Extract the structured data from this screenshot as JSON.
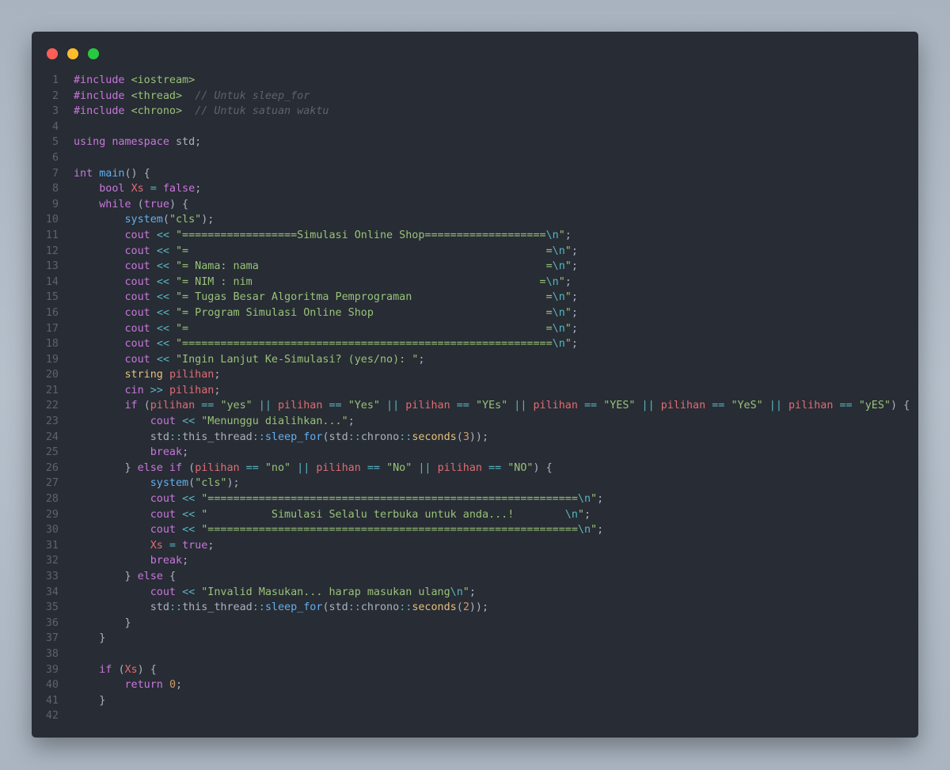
{
  "window": {
    "controls": [
      {
        "name": "close",
        "color": "#ff5f56"
      },
      {
        "name": "minimize",
        "color": "#ffbd2e"
      },
      {
        "name": "maximize",
        "color": "#27c93f"
      }
    ]
  },
  "code": {
    "lines": [
      [
        [
          "pre",
          "#include "
        ],
        [
          "inc",
          "<iostream>"
        ]
      ],
      [
        [
          "pre",
          "#include "
        ],
        [
          "inc",
          "<thread>"
        ],
        [
          "plain",
          "  "
        ],
        [
          "com",
          "// Untuk sleep_for"
        ]
      ],
      [
        [
          "pre",
          "#include "
        ],
        [
          "inc",
          "<chrono>"
        ],
        [
          "plain",
          "  "
        ],
        [
          "com",
          "// Untuk satuan waktu"
        ]
      ],
      [],
      [
        [
          "kw",
          "using namespace "
        ],
        [
          "plain",
          "std;"
        ]
      ],
      [],
      [
        [
          "kw",
          "int "
        ],
        [
          "func",
          "main"
        ],
        [
          "plain",
          "() {"
        ]
      ],
      [
        [
          "plain",
          "    "
        ],
        [
          "kw",
          "bool "
        ],
        [
          "var",
          "Xs"
        ],
        [
          "op",
          " = "
        ],
        [
          "kw",
          "false"
        ],
        [
          "plain",
          ";"
        ]
      ],
      [
        [
          "plain",
          "    "
        ],
        [
          "kw",
          "while "
        ],
        [
          "plain",
          "("
        ],
        [
          "kw",
          "true"
        ],
        [
          "plain",
          ") {"
        ]
      ],
      [
        [
          "plain",
          "        "
        ],
        [
          "func",
          "system"
        ],
        [
          "plain",
          "("
        ],
        [
          "str",
          "\"cls\""
        ],
        [
          "plain",
          ");"
        ]
      ],
      [
        [
          "plain",
          "        "
        ],
        [
          "kw",
          "cout "
        ],
        [
          "op",
          "<< "
        ],
        [
          "str",
          "\"==================Simulasi Online Shop==================="
        ],
        [
          "esc",
          "\\n"
        ],
        [
          "str",
          "\""
        ],
        [
          "plain",
          ";"
        ]
      ],
      [
        [
          "plain",
          "        "
        ],
        [
          "kw",
          "cout "
        ],
        [
          "op",
          "<< "
        ],
        [
          "str",
          "\"=                                                        ="
        ],
        [
          "esc",
          "\\n"
        ],
        [
          "str",
          "\""
        ],
        [
          "plain",
          ";"
        ]
      ],
      [
        [
          "plain",
          "        "
        ],
        [
          "kw",
          "cout "
        ],
        [
          "op",
          "<< "
        ],
        [
          "str",
          "\"= Nama: nama                                             ="
        ],
        [
          "esc",
          "\\n"
        ],
        [
          "str",
          "\""
        ],
        [
          "plain",
          ";"
        ]
      ],
      [
        [
          "plain",
          "        "
        ],
        [
          "kw",
          "cout "
        ],
        [
          "op",
          "<< "
        ],
        [
          "str",
          "\"= NIM : nim                                             ="
        ],
        [
          "esc",
          "\\n"
        ],
        [
          "str",
          "\""
        ],
        [
          "plain",
          ";"
        ]
      ],
      [
        [
          "plain",
          "        "
        ],
        [
          "kw",
          "cout "
        ],
        [
          "op",
          "<< "
        ],
        [
          "str",
          "\"= Tugas Besar Algoritma Pemprograman                     ="
        ],
        [
          "esc",
          "\\n"
        ],
        [
          "str",
          "\""
        ],
        [
          "plain",
          ";"
        ]
      ],
      [
        [
          "plain",
          "        "
        ],
        [
          "kw",
          "cout "
        ],
        [
          "op",
          "<< "
        ],
        [
          "str",
          "\"= Program Simulasi Online Shop                           ="
        ],
        [
          "esc",
          "\\n"
        ],
        [
          "str",
          "\""
        ],
        [
          "plain",
          ";"
        ]
      ],
      [
        [
          "plain",
          "        "
        ],
        [
          "kw",
          "cout "
        ],
        [
          "op",
          "<< "
        ],
        [
          "str",
          "\"=                                                        ="
        ],
        [
          "esc",
          "\\n"
        ],
        [
          "str",
          "\""
        ],
        [
          "plain",
          ";"
        ]
      ],
      [
        [
          "plain",
          "        "
        ],
        [
          "kw",
          "cout "
        ],
        [
          "op",
          "<< "
        ],
        [
          "str",
          "\"=========================================================="
        ],
        [
          "esc",
          "\\n"
        ],
        [
          "str",
          "\""
        ],
        [
          "plain",
          ";"
        ]
      ],
      [
        [
          "plain",
          "        "
        ],
        [
          "kw",
          "cout "
        ],
        [
          "op",
          "<< "
        ],
        [
          "str",
          "\"Ingin Lanjut Ke-Simulasi? (yes/no): \""
        ],
        [
          "plain",
          ";"
        ]
      ],
      [
        [
          "plain",
          "        "
        ],
        [
          "type",
          "string "
        ],
        [
          "var",
          "pilihan"
        ],
        [
          "plain",
          ";"
        ]
      ],
      [
        [
          "plain",
          "        "
        ],
        [
          "kw",
          "cin "
        ],
        [
          "op",
          ">> "
        ],
        [
          "var",
          "pilihan"
        ],
        [
          "plain",
          ";"
        ]
      ],
      [
        [
          "plain",
          "        "
        ],
        [
          "kw",
          "if "
        ],
        [
          "plain",
          "("
        ],
        [
          "var",
          "pilihan"
        ],
        [
          "op",
          " == "
        ],
        [
          "str",
          "\"yes\""
        ],
        [
          "op",
          " || "
        ],
        [
          "var",
          "pilihan"
        ],
        [
          "op",
          " == "
        ],
        [
          "str",
          "\"Yes\""
        ],
        [
          "op",
          " || "
        ],
        [
          "var",
          "pilihan"
        ],
        [
          "op",
          " == "
        ],
        [
          "str",
          "\"YEs\""
        ],
        [
          "op",
          " || "
        ],
        [
          "var",
          "pilihan"
        ],
        [
          "op",
          " == "
        ],
        [
          "str",
          "\"YES\""
        ],
        [
          "op",
          " || "
        ],
        [
          "var",
          "pilihan"
        ],
        [
          "op",
          " == "
        ],
        [
          "str",
          "\"YeS\""
        ],
        [
          "op",
          " || "
        ],
        [
          "var",
          "pilihan"
        ],
        [
          "op",
          " == "
        ],
        [
          "str",
          "\"yES\""
        ],
        [
          "plain",
          ") {"
        ]
      ],
      [
        [
          "plain",
          "            "
        ],
        [
          "kw",
          "cout "
        ],
        [
          "op",
          "<< "
        ],
        [
          "str",
          "\"Menunggu dialihkan...\""
        ],
        [
          "plain",
          ";"
        ]
      ],
      [
        [
          "plain",
          "            std"
        ],
        [
          "op",
          "::"
        ],
        [
          "plain",
          "this_thread"
        ],
        [
          "op",
          "::"
        ],
        [
          "func",
          "sleep_for"
        ],
        [
          "plain",
          "(std"
        ],
        [
          "op",
          "::"
        ],
        [
          "plain",
          "chrono"
        ],
        [
          "op",
          "::"
        ],
        [
          "fn2",
          "seconds"
        ],
        [
          "plain",
          "("
        ],
        [
          "num",
          "3"
        ],
        [
          "plain",
          "));"
        ]
      ],
      [
        [
          "plain",
          "            "
        ],
        [
          "kw",
          "break"
        ],
        [
          "plain",
          ";"
        ]
      ],
      [
        [
          "plain",
          "        } "
        ],
        [
          "kw",
          "else if "
        ],
        [
          "plain",
          "("
        ],
        [
          "var",
          "pilihan"
        ],
        [
          "op",
          " == "
        ],
        [
          "str",
          "\"no\""
        ],
        [
          "op",
          " || "
        ],
        [
          "var",
          "pilihan"
        ],
        [
          "op",
          " == "
        ],
        [
          "str",
          "\"No\""
        ],
        [
          "op",
          " || "
        ],
        [
          "var",
          "pilihan"
        ],
        [
          "op",
          " == "
        ],
        [
          "str",
          "\"NO\""
        ],
        [
          "plain",
          ") {"
        ]
      ],
      [
        [
          "plain",
          "            "
        ],
        [
          "func",
          "system"
        ],
        [
          "plain",
          "("
        ],
        [
          "str",
          "\"cls\""
        ],
        [
          "plain",
          ");"
        ]
      ],
      [
        [
          "plain",
          "            "
        ],
        [
          "kw",
          "cout "
        ],
        [
          "op",
          "<< "
        ],
        [
          "str",
          "\"=========================================================="
        ],
        [
          "esc",
          "\\n"
        ],
        [
          "str",
          "\""
        ],
        [
          "plain",
          ";"
        ]
      ],
      [
        [
          "plain",
          "            "
        ],
        [
          "kw",
          "cout "
        ],
        [
          "op",
          "<< "
        ],
        [
          "str",
          "\"          Simulasi Selalu terbuka untuk anda...!        "
        ],
        [
          "esc",
          "\\n"
        ],
        [
          "str",
          "\""
        ],
        [
          "plain",
          ";"
        ]
      ],
      [
        [
          "plain",
          "            "
        ],
        [
          "kw",
          "cout "
        ],
        [
          "op",
          "<< "
        ],
        [
          "str",
          "\"=========================================================="
        ],
        [
          "esc",
          "\\n"
        ],
        [
          "str",
          "\""
        ],
        [
          "plain",
          ";"
        ]
      ],
      [
        [
          "plain",
          "            "
        ],
        [
          "var",
          "Xs"
        ],
        [
          "op",
          " = "
        ],
        [
          "kw",
          "true"
        ],
        [
          "plain",
          ";"
        ]
      ],
      [
        [
          "plain",
          "            "
        ],
        [
          "kw",
          "break"
        ],
        [
          "plain",
          ";"
        ]
      ],
      [
        [
          "plain",
          "        } "
        ],
        [
          "kw",
          "else "
        ],
        [
          "plain",
          "{"
        ]
      ],
      [
        [
          "plain",
          "            "
        ],
        [
          "kw",
          "cout "
        ],
        [
          "op",
          "<< "
        ],
        [
          "str",
          "\"Invalid Masukan... harap masukan ulang"
        ],
        [
          "esc",
          "\\n"
        ],
        [
          "str",
          "\""
        ],
        [
          "plain",
          ";"
        ]
      ],
      [
        [
          "plain",
          "            std"
        ],
        [
          "op",
          "::"
        ],
        [
          "plain",
          "this_thread"
        ],
        [
          "op",
          "::"
        ],
        [
          "func",
          "sleep_for"
        ],
        [
          "plain",
          "(std"
        ],
        [
          "op",
          "::"
        ],
        [
          "plain",
          "chrono"
        ],
        [
          "op",
          "::"
        ],
        [
          "fn2",
          "seconds"
        ],
        [
          "plain",
          "("
        ],
        [
          "num",
          "2"
        ],
        [
          "plain",
          "));"
        ]
      ],
      [
        [
          "plain",
          "        }"
        ]
      ],
      [
        [
          "plain",
          "    }"
        ]
      ],
      [],
      [
        [
          "plain",
          "    "
        ],
        [
          "kw",
          "if "
        ],
        [
          "plain",
          "("
        ],
        [
          "var",
          "Xs"
        ],
        [
          "plain",
          ") {"
        ]
      ],
      [
        [
          "plain",
          "        "
        ],
        [
          "kw",
          "return "
        ],
        [
          "num",
          "0"
        ],
        [
          "plain",
          ";"
        ]
      ],
      [
        [
          "plain",
          "    }"
        ]
      ],
      []
    ]
  }
}
